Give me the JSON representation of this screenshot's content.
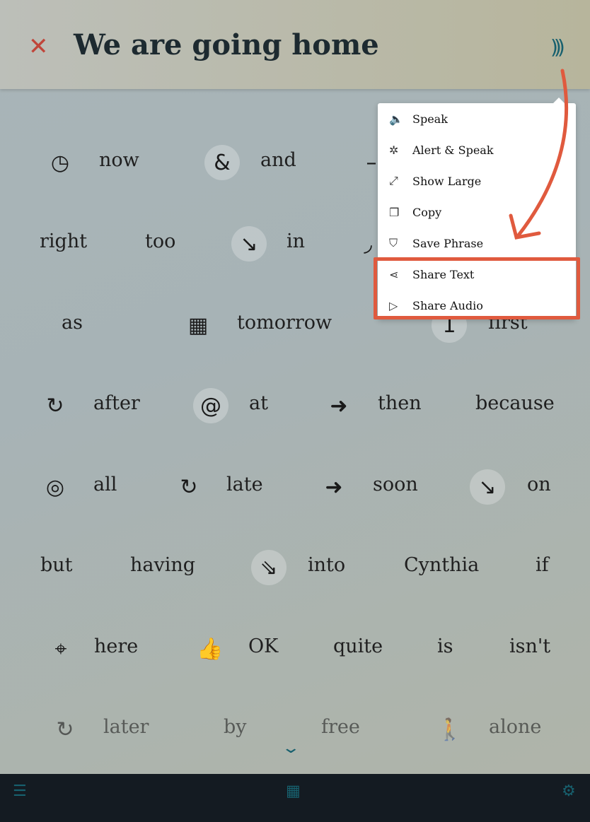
{
  "header": {
    "title": "We are going home",
    "close_icon": "close-icon",
    "speak_icon": "sound-waves-icon"
  },
  "accent": "#17606e",
  "highlight": "#e05a3e",
  "rows": [
    [
      {
        "label": "now",
        "icon": "clock-arrow-icon",
        "glyph": "◷"
      },
      {
        "label": "and",
        "icon": "ampersand-icon",
        "glyph": "&"
      },
      {
        "label": "",
        "icon": "partial-icon",
        "glyph": "–"
      }
    ],
    [
      {
        "label": "right"
      },
      {
        "label": "too"
      },
      {
        "label": "in",
        "icon": "arrow-in-icon",
        "glyph": "↘"
      },
      {
        "label": "",
        "icon": "partial-icon",
        "glyph": "◞"
      }
    ],
    [
      {
        "label": "as"
      },
      {
        "label": "tomorrow",
        "icon": "calendar-icon",
        "glyph": "▦"
      },
      {
        "label": "first",
        "icon": "first-icon",
        "glyph": "1"
      }
    ],
    [
      {
        "label": "after",
        "icon": "clock-forward-icon",
        "glyph": "↻"
      },
      {
        "label": "at",
        "icon": "at-icon",
        "glyph": "@"
      },
      {
        "label": "then",
        "icon": "arrow-circle-icon",
        "glyph": "➜"
      },
      {
        "label": "because"
      }
    ],
    [
      {
        "label": "all",
        "icon": "target-circle-icon",
        "glyph": "◎"
      },
      {
        "label": "late",
        "icon": "clock-forward-icon",
        "glyph": "↻"
      },
      {
        "label": "soon",
        "icon": "arrow-circle-icon",
        "glyph": "➜"
      },
      {
        "label": "on",
        "icon": "arrow-on-icon",
        "glyph": "↘"
      }
    ],
    [
      {
        "label": "but"
      },
      {
        "label": "having"
      },
      {
        "label": "into",
        "icon": "arrow-into-icon",
        "glyph": "⇘"
      },
      {
        "label": "Cynthia"
      },
      {
        "label": "if"
      }
    ],
    [
      {
        "label": "here",
        "icon": "location-pin-icon",
        "glyph": "⌖"
      },
      {
        "label": "OK",
        "icon": "thumbs-up-icon",
        "glyph": "👍"
      },
      {
        "label": "quite"
      },
      {
        "label": "is"
      },
      {
        "label": "isn't"
      }
    ],
    [
      {
        "label": "later",
        "icon": "clock-forward-icon",
        "glyph": "↻"
      },
      {
        "label": "by"
      },
      {
        "label": "free"
      },
      {
        "label": "alone",
        "icon": "person-standing-icon",
        "glyph": "🚶"
      }
    ]
  ],
  "menu": {
    "items": [
      {
        "label": "Speak",
        "icon": "speaker-icon",
        "glyph": "🔈"
      },
      {
        "label": "Alert & Speak",
        "icon": "alert-speaker-icon",
        "glyph": "✲"
      },
      {
        "label": "Show Large",
        "icon": "expand-icon",
        "glyph": "⤢"
      },
      {
        "label": "Copy",
        "icon": "copy-icon",
        "glyph": "❐"
      },
      {
        "label": "Save Phrase",
        "icon": "bookmark-icon",
        "glyph": "⛉"
      },
      {
        "label": "Share Text",
        "icon": "share-icon",
        "glyph": "⋖"
      },
      {
        "label": "Share Audio",
        "icon": "play-icon",
        "glyph": "▷"
      }
    ]
  },
  "footer": {
    "left_icon": "list-icon",
    "center_icon": "keyboard-grid-icon",
    "right_icon": "gear-icon"
  },
  "more_icon": "chevron-down-icon"
}
